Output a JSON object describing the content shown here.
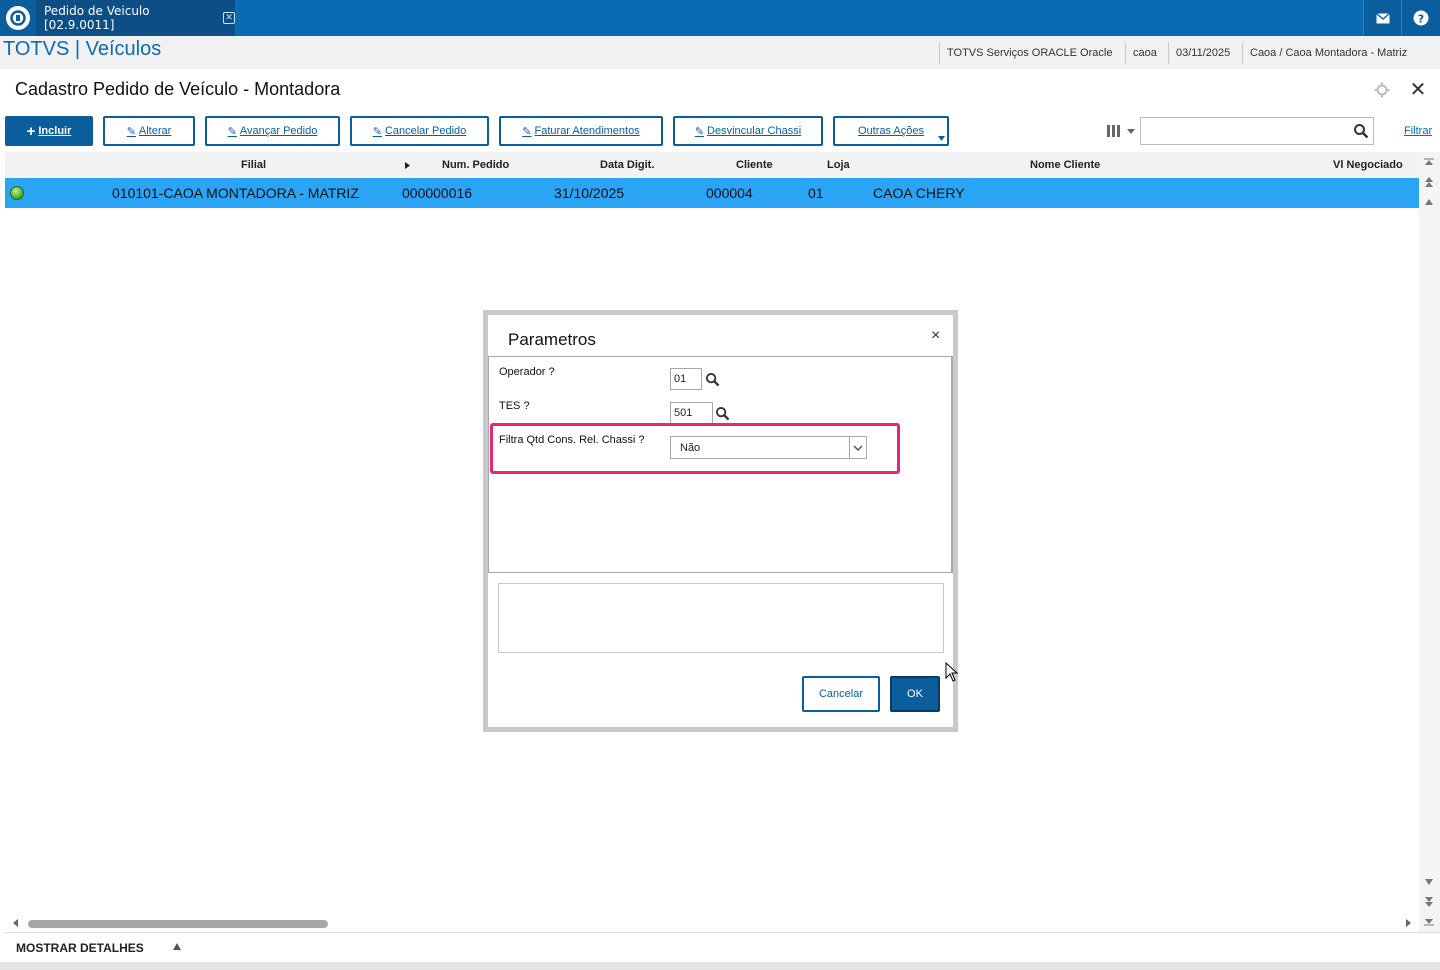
{
  "window": {
    "tab_title": "Pedido de Veiculo [02.9.0011]",
    "tab_close_glyph": "✕",
    "mail_icon": "mail-icon",
    "help_icon": "help-icon"
  },
  "header": {
    "brand": "TOTVS | Veículos",
    "environment": "TOTVS Serviços ORACLE Oracle",
    "user": "caoa",
    "date": "03/11/2025",
    "company": "Caoa / Caoa Montadora - Matriz"
  },
  "page": {
    "title": "Cadastro Pedido de Veículo - Montadora",
    "close_glyph": "✕"
  },
  "toolbar": {
    "incluir": "Incluir",
    "alterar": "Alterar",
    "avancar": "Avançar Pedido",
    "cancelar": "Cancelar Pedido",
    "faturar": "Faturar Atendimentos",
    "desvincular": "Desvincular Chassi",
    "outras": "Outras Ações",
    "search_value": "",
    "filtrar": "Filtrar"
  },
  "grid": {
    "columns": [
      "Filial",
      "Num. Pedido",
      "Data Digit.",
      "Cliente",
      "Loja",
      "Nome Cliente",
      "Vl Negociado"
    ],
    "rows": [
      {
        "status": "green",
        "filial": "010101-CAOA MONTADORA - MATRIZ",
        "num_pedido": "000000016",
        "data_digit": "31/10/2025",
        "cliente": "000004",
        "loja": "01",
        "nome_cliente": "CAOA CHERY",
        "vl_negociado": ""
      }
    ]
  },
  "footer": {
    "label": "MOSTRAR DETALHES"
  },
  "dialog": {
    "title": "Parametros",
    "close_glyph": "×",
    "fields": [
      {
        "label": "Operador ?",
        "value": "01"
      },
      {
        "label": "TES ?",
        "value": "501"
      },
      {
        "label": "Filtra Qtd Cons. Rel. Chassi ?",
        "value": "Não"
      }
    ],
    "cancel": "Cancelar",
    "ok": "OK"
  },
  "colors": {
    "topbar": "#0a6ab2",
    "primary": "#0b5e9e",
    "selected_row": "#2aa4f4",
    "highlight": "#e0287a"
  }
}
